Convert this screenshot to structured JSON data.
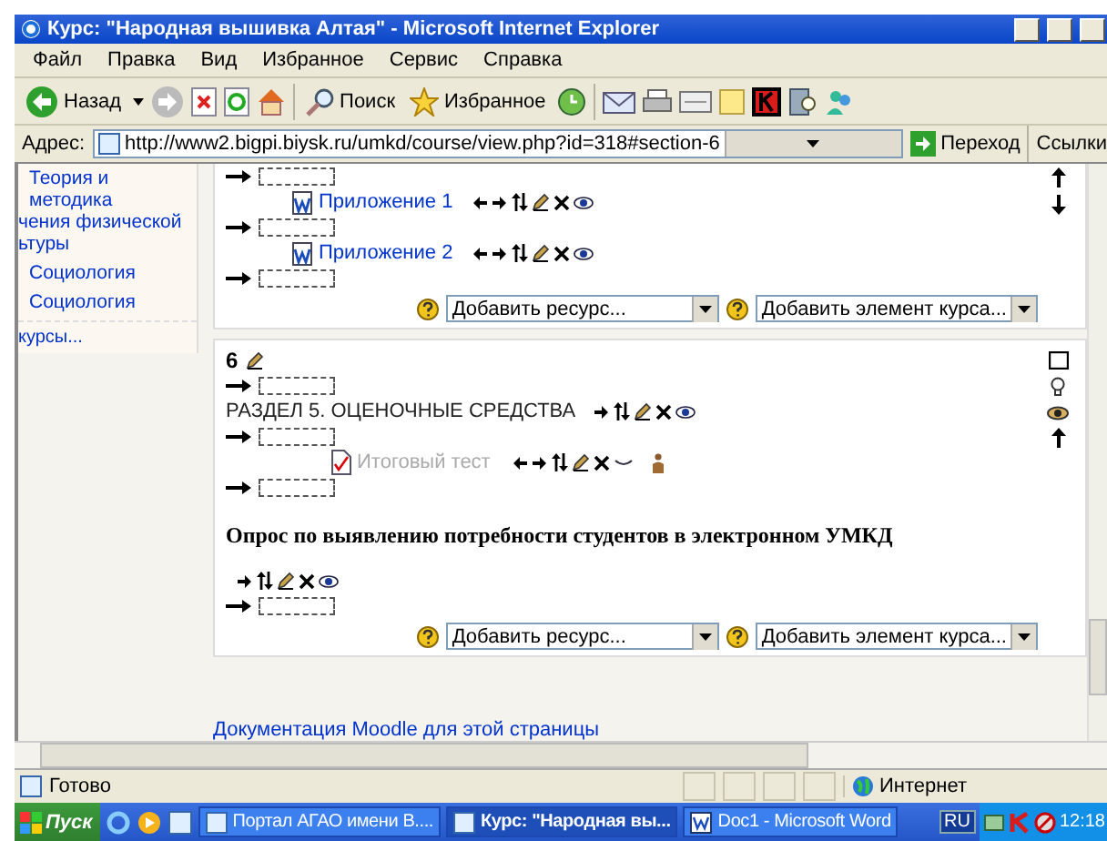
{
  "window": {
    "title": "Курс: \"Народная вышивка Алтая\" - Microsoft Internet Explorer"
  },
  "menu": [
    "Файл",
    "Правка",
    "Вид",
    "Избранное",
    "Сервис",
    "Справка"
  ],
  "toolbar": {
    "back": "Назад",
    "search": "Поиск",
    "favorites": "Избранное"
  },
  "address_bar": {
    "label": "Адрес:",
    "value": "http://www2.bigpi.biysk.ru/umkd/course/view.php?id=318#section-6",
    "go": "Переход",
    "links": "Ссылки"
  },
  "sidebar": {
    "items": [
      {
        "lines": [
          "Теория и",
          "методика",
          "чения физической",
          "ьтуры"
        ]
      },
      {
        "lines": [
          "Социология"
        ]
      },
      {
        "lines": [
          "Социология"
        ]
      }
    ],
    "more": "курсы..."
  },
  "sections": [
    {
      "items": [
        {
          "kind": "slot"
        },
        {
          "kind": "resource",
          "title": "Приложение 1",
          "visible": true
        },
        {
          "kind": "slot"
        },
        {
          "kind": "resource",
          "title": "Приложение 2",
          "visible": true
        },
        {
          "kind": "slot"
        }
      ],
      "add_resource": "Добавить ресурс...",
      "add_activity": "Добавить элемент курса..."
    },
    {
      "number": "6",
      "items": [
        {
          "kind": "slot"
        },
        {
          "kind": "label",
          "title": "РАЗДЕЛ 5. ОЦЕНОЧНЫЕ СРЕДСТВА",
          "visible": true
        },
        {
          "kind": "slot"
        },
        {
          "kind": "quiz",
          "title": "Итоговый тест",
          "visible": false
        },
        {
          "kind": "slot"
        },
        {
          "kind": "bold_label",
          "title": "Опрос по выявлению потребности студентов в электронном УМКД",
          "visible": true
        },
        {
          "kind": "slot"
        }
      ],
      "add_resource": "Добавить ресурс...",
      "add_activity": "Добавить элемент курса..."
    }
  ],
  "footer_link": "Документация Moodle для этой страницы",
  "status_bar": {
    "text": "Готово",
    "zone": "Интернет"
  },
  "taskbar": {
    "start": "Пуск",
    "tasks": [
      {
        "label": "Портал АГАО имени В....",
        "selected": false
      },
      {
        "label": "Курс: \"Народная вы...",
        "selected": true
      },
      {
        "label": "Doc1 - Microsoft Word",
        "selected": false
      }
    ],
    "language": "RU",
    "clock": "12:18"
  }
}
